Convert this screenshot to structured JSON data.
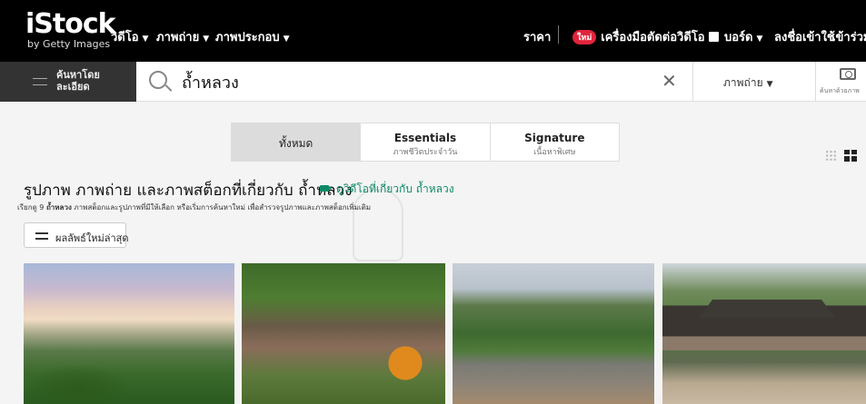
{
  "logo": {
    "brand": "iStock",
    "sub": "by Getty Images"
  },
  "nav": {
    "videos": "วิดีโอ",
    "photos": "ภาพถ่าย",
    "illustrations": "ภาพประกอบ",
    "pricing": "ราคา",
    "new_badge": "ใหม่",
    "video_editor": "เครื่องมือตัดต่อวิดีโอ",
    "boards": "บอร์ด",
    "signup": "ลงชื่อเข้าใช้",
    "join": "เข้าร่วม"
  },
  "search": {
    "refine_label_1": "ค้นหาโดย",
    "refine_label_2": "ละเอียด",
    "query": "ถ้ำหลวง",
    "type_select": "ภาพถ่าย",
    "camera_label": "ค้นหาด้วยภาพ"
  },
  "tabs": [
    {
      "title": "ทั้งหมด",
      "sub": ""
    },
    {
      "title": "Essentials",
      "sub": "ภาพชีวิตประจำวัน"
    },
    {
      "title": "Signature",
      "sub": "เนื้อหาพิเศษ"
    }
  ],
  "heading": {
    "title": "รูปภาพ ภาพถ่าย และภาพสต็อกที่เกี่ยวกับ ถ้ำหลวง",
    "video_link": "ดูวิดีโอที่เกี่ยวกับ ถ้ำหลวง",
    "browse_prefix": "เรียกดู 9 ",
    "browse_term": "ถ้ำหลวง",
    "browse_rest": " ภาพสต็อกและรูปภาพที่มีให้เลือก หรือเริ่มการค้นหาใหม่ เพื่อสำรวจรูปภาพและภาพสต็อกเพิ่มเติม"
  },
  "sort": {
    "label": "ผลลัพธ์ใหม่ล่าสุด"
  },
  "colors": {
    "brand_black": "#000000",
    "accent_green": "#0b8a67",
    "new_badge": "#e2243b"
  },
  "icons": [
    "refine-icon",
    "search-icon",
    "clear-icon",
    "camera-icon",
    "video-icon",
    "grid-view-icon",
    "mosaic-view-icon",
    "sort-icon"
  ]
}
